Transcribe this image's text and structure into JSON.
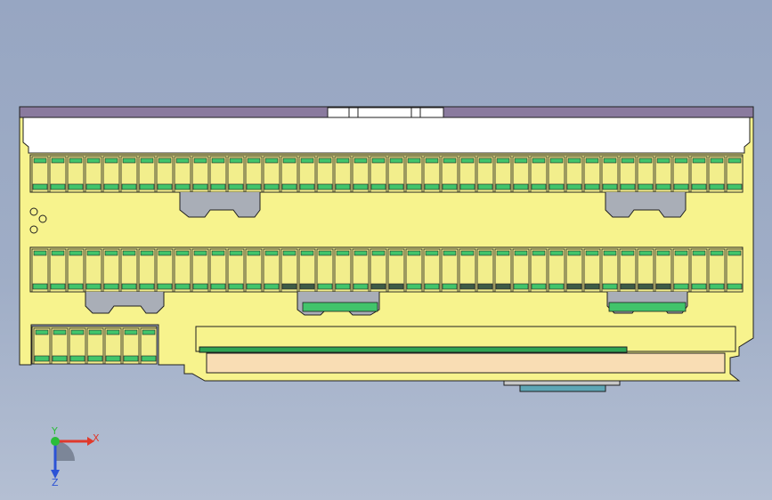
{
  "viewport": {
    "colors": {
      "body": "#f7f38d",
      "body_dark": "#d9d56a",
      "outline": "#1f1f1f",
      "lid": "#8a7a9e",
      "white_strip": "#ffffff",
      "terminal_green": "#41c46b",
      "terminal_dark": "#3d5b46",
      "gray_part": "#a9aeb7",
      "pcb_green": "#2ea353",
      "label_strip": "#f9ddb4",
      "connector_teal": "#5ea6b5"
    }
  },
  "triad": {
    "x_label": "X",
    "y_label": "Y",
    "z_label": "Z",
    "colors": {
      "x": "#e0392b",
      "y": "#2bbd3a",
      "z": "#2c53d6"
    }
  }
}
